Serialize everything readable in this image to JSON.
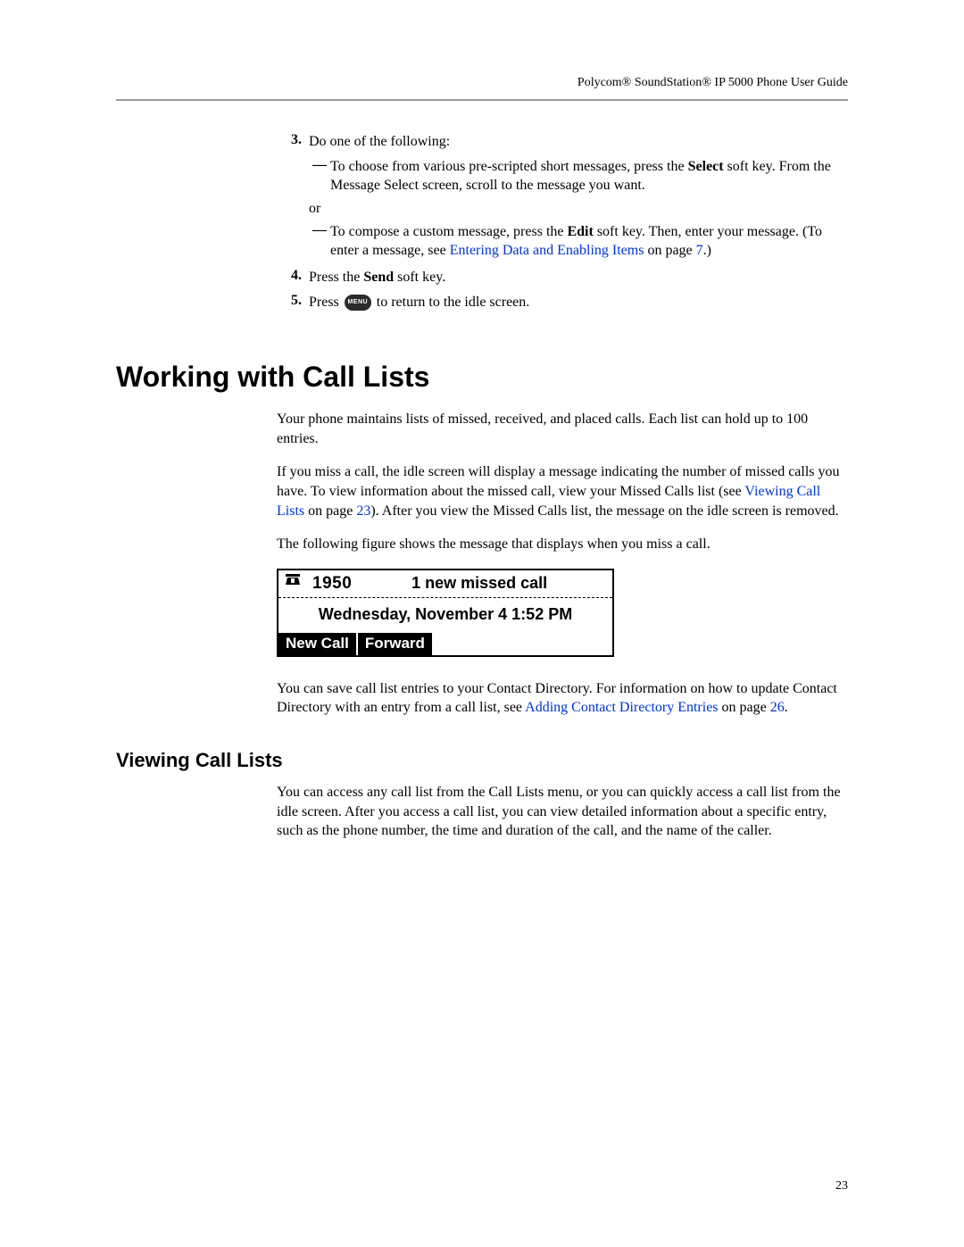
{
  "header": "Polycom® SoundStation® IP 5000 Phone User Guide",
  "steps": {
    "s3": {
      "num": "3.",
      "intro": "Do one of the following:",
      "opt1_a": "To choose from various pre-scripted short messages, press the ",
      "opt1_b": "Select",
      "opt1_c": " soft key. From the Message Select screen, scroll to the message you want.",
      "or": "or",
      "opt2_a": "To compose a custom message, press the ",
      "opt2_b": "Edit",
      "opt2_c": " soft key. Then, enter your message. (To enter a message, see ",
      "opt2_link": "Entering Data and Enabling Items",
      "opt2_d": " on page ",
      "opt2_page": "7",
      "opt2_e": ".)"
    },
    "s4": {
      "num": "4.",
      "a": "Press the ",
      "b": "Send",
      "c": " soft key."
    },
    "s5": {
      "num": "5.",
      "a": "Press ",
      "icon": "MENU",
      "b": " to return to the idle screen."
    }
  },
  "h1": "Working with Call Lists",
  "p1": "Your phone maintains lists of missed, received, and placed calls. Each list can hold up to 100 entries.",
  "p2_a": "If you miss a call, the idle screen will display a message indicating the number of missed calls you have. To view information about the missed call, view your Missed Calls list (see ",
  "p2_link": "Viewing Call Lists",
  "p2_b": " on page ",
  "p2_page": "23",
  "p2_c": "). After you view the Missed Calls list, the message on the idle screen is removed.",
  "p3": "The following figure shows the message that displays when you miss a call.",
  "phone": {
    "ext": "1950",
    "missed": "1 new missed call",
    "date": "Wednesday, November 4   1:52 PM",
    "sk1": "New Call",
    "sk2": "Forward"
  },
  "p4_a": "You can save call list entries to your Contact Directory. For information on how to update Contact Directory with an entry from a call list, see ",
  "p4_link": "Adding Contact Directory Entries",
  "p4_b": " on page ",
  "p4_page": "26",
  "p4_c": ".",
  "h2": "Viewing Call Lists",
  "p5": "You can access any call list from the Call Lists menu, or you can quickly access a call list from the idle screen. After you access a call list, you can view detailed information about a specific entry, such as the phone number, the time and duration of the call, and the name of the caller.",
  "pagenum": "23"
}
